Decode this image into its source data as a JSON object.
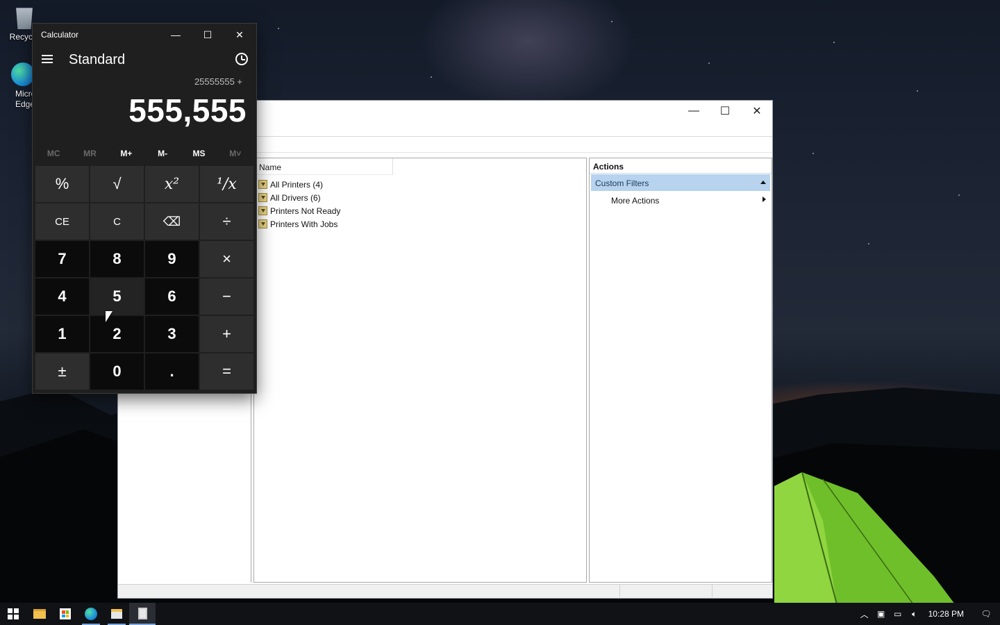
{
  "desktop": {
    "icons": [
      {
        "label": "Recycle",
        "icon": "recycle-bin-icon"
      },
      {
        "label": "Micros Edge",
        "icon": "edge-icon"
      }
    ]
  },
  "print_management": {
    "window_controls": {
      "minimize": "—",
      "maximize": "☐",
      "close": "✕"
    },
    "column_header": "Name",
    "items": [
      {
        "label": "All Printers (4)",
        "icon": "filter-icon"
      },
      {
        "label": "All Drivers (6)",
        "icon": "filter-icon"
      },
      {
        "label": "Printers Not Ready",
        "icon": "filter-icon"
      },
      {
        "label": "Printers With Jobs",
        "icon": "filter-icon"
      }
    ],
    "actions": {
      "header": "Actions",
      "section": "Custom Filters",
      "items": [
        "More Actions"
      ]
    }
  },
  "calculator": {
    "title": "Calculator",
    "window_controls": {
      "minimize": "—",
      "maximize": "☐",
      "close": "✕"
    },
    "mode": "Standard",
    "expression": "25555555 +",
    "display": "555,555",
    "memory": [
      {
        "label": "MC",
        "enabled": false
      },
      {
        "label": "MR",
        "enabled": false
      },
      {
        "label": "M+",
        "enabled": true
      },
      {
        "label": "M-",
        "enabled": true
      },
      {
        "label": "MS",
        "enabled": true
      },
      {
        "label": "M˅",
        "enabled": false
      }
    ],
    "keys": [
      {
        "label": "%",
        "type": "op"
      },
      {
        "label": "√",
        "type": "op"
      },
      {
        "label": "x²",
        "type": "op"
      },
      {
        "label": "¹/x",
        "type": "op"
      },
      {
        "label": "CE",
        "type": "op"
      },
      {
        "label": "C",
        "type": "op"
      },
      {
        "label": "⌫",
        "type": "op"
      },
      {
        "label": "÷",
        "type": "op"
      },
      {
        "label": "7",
        "type": "num"
      },
      {
        "label": "8",
        "type": "num"
      },
      {
        "label": "9",
        "type": "num"
      },
      {
        "label": "×",
        "type": "op"
      },
      {
        "label": "4",
        "type": "num"
      },
      {
        "label": "5",
        "type": "num"
      },
      {
        "label": "6",
        "type": "num"
      },
      {
        "label": "−",
        "type": "op"
      },
      {
        "label": "1",
        "type": "num"
      },
      {
        "label": "2",
        "type": "num"
      },
      {
        "label": "3",
        "type": "num"
      },
      {
        "label": "+",
        "type": "op"
      },
      {
        "label": "±",
        "type": "op"
      },
      {
        "label": "0",
        "type": "num"
      },
      {
        "label": ".",
        "type": "num"
      },
      {
        "label": "=",
        "type": "op"
      }
    ]
  },
  "taskbar": {
    "items": [
      "start-button",
      "file-explorer",
      "microsoft-store",
      "edge",
      "print-management",
      "calculator"
    ],
    "clock": "10:28 PM",
    "tray": [
      "chevron-up-icon",
      "meet-now-icon",
      "network-icon",
      "volume-icon"
    ]
  },
  "colors": {
    "accent": "#7aa7e0",
    "actions_section_bg": "#b7d3ee",
    "calc_bg": "#1f1f1f"
  }
}
